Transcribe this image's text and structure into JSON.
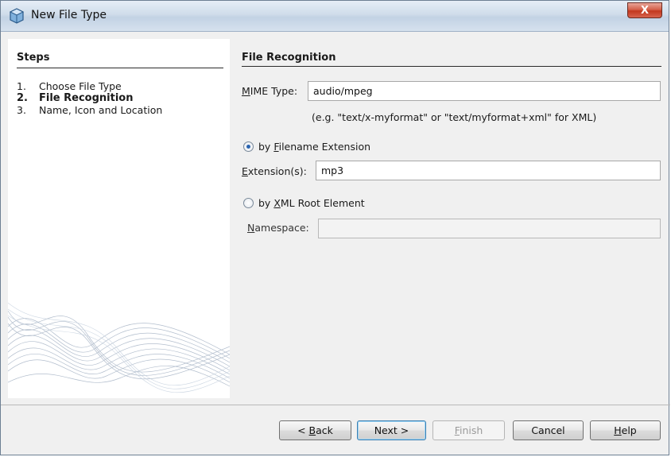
{
  "window": {
    "title": "New File Type",
    "close_label": "X"
  },
  "steps": {
    "heading": "Steps",
    "items": [
      {
        "num": "1.",
        "label": "Choose File Type"
      },
      {
        "num": "2.",
        "label": "File Recognition"
      },
      {
        "num": "3.",
        "label": "Name, Icon and Location"
      }
    ],
    "current_index": 1
  },
  "form": {
    "heading": "File Recognition",
    "mime_label_prefix": "M",
    "mime_label_rest": "IME Type:",
    "mime_value": "audio/mpeg",
    "mime_hint": "(e.g. \"text/x-myformat\" or \"text/myformat+xml\" for XML)",
    "radio_ext_prefix": "by ",
    "radio_ext_mnemonic": "F",
    "radio_ext_rest": "ilename Extension",
    "radio_ext_checked": true,
    "ext_label_mnemonic": "E",
    "ext_label_rest": "xtension(s):",
    "ext_value": "mp3",
    "radio_xml_prefix": "by ",
    "radio_xml_mnemonic": "X",
    "radio_xml_rest": "ML Root Element",
    "radio_xml_checked": false,
    "ns_label_mnemonic": "N",
    "ns_label_rest": "amespace:",
    "ns_value": ""
  },
  "buttons": {
    "back_prefix": "< ",
    "back_mnemonic": "B",
    "back_rest": "ack",
    "next": "Next >",
    "finish_mnemonic": "F",
    "finish_rest": "inish",
    "cancel": "Cancel",
    "help_mnemonic": "H",
    "help_rest": "elp"
  },
  "colors": {
    "accent": "#2b64b0",
    "close": "#c2381f",
    "title_bar": "#cfdcea"
  }
}
